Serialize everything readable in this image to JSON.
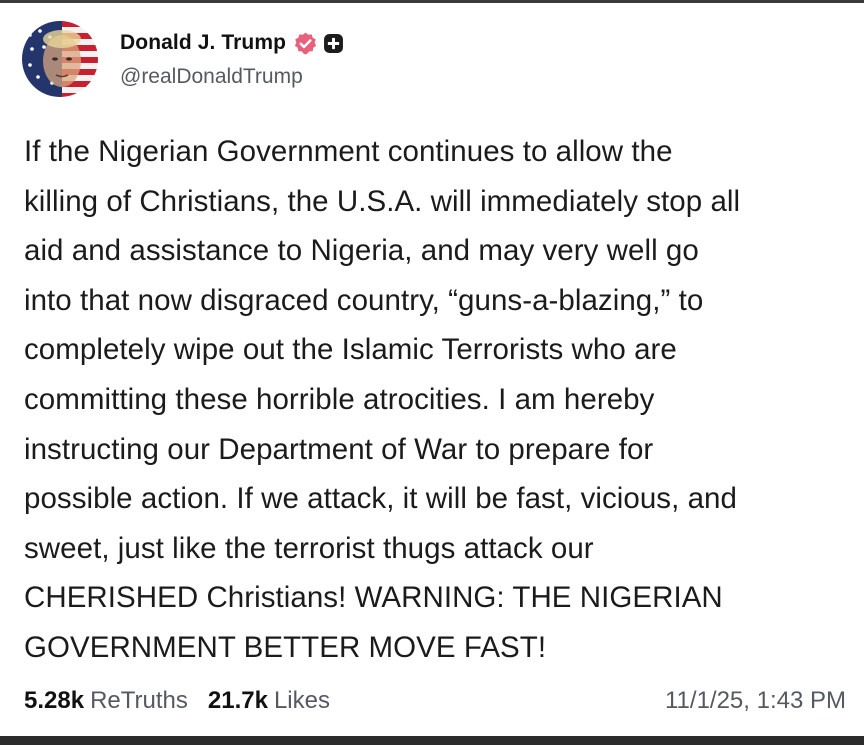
{
  "profile": {
    "display_name": "Donald J. Trump",
    "handle": "@realDonaldTrump",
    "verified_icon": "verified-badge-icon",
    "extra_icon": "plus-badge-icon",
    "avatar_icon": "profile-avatar"
  },
  "post": {
    "lines": [
      "If the Nigerian Government continues to allow the",
      "killing of Christians, the U.S.A. will immediately stop all",
      "aid and assistance to Nigeria, and may very well go",
      "into that now disgraced country, “guns-a-blazing,” to",
      "completely wipe out the Islamic Terrorists who are",
      "committing these horrible atrocities. I am hereby",
      "instructing our Department of War to prepare for",
      "possible action. If we attack, it will be fast, vicious, and",
      "sweet, just like the terrorist thugs attack our",
      "CHERISHED Christians! WARNING: THE NIGERIAN",
      "GOVERNMENT BETTER MOVE FAST!"
    ]
  },
  "stats": {
    "retruths_count": "5.28k",
    "retruths_label": "ReTruths",
    "likes_count": "21.7k",
    "likes_label": "Likes",
    "timestamp": "11/1/25, 1:43 PM"
  },
  "colors": {
    "verified_badge": "#e8607a",
    "text_primary": "#111111",
    "text_secondary": "#555a60"
  }
}
